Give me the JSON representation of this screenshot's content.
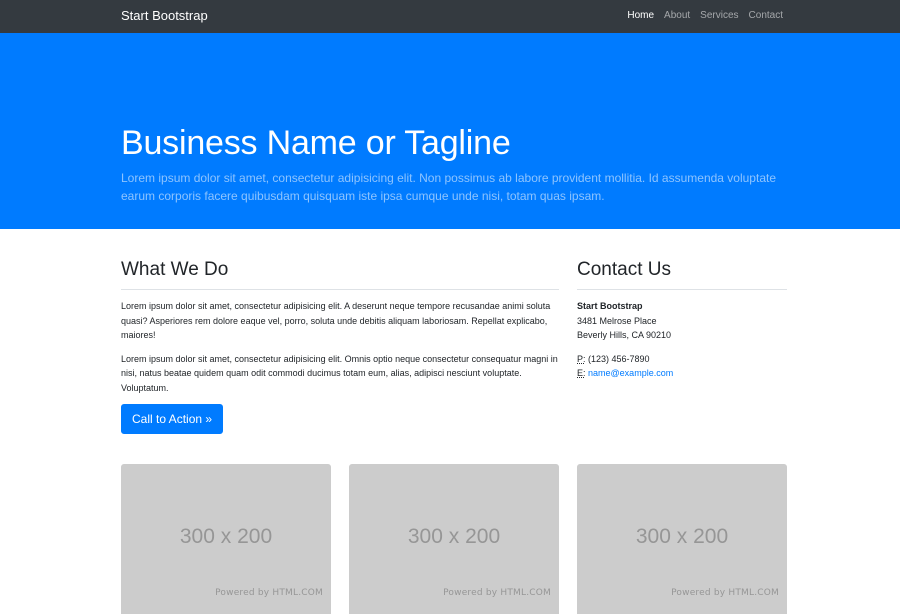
{
  "navbar": {
    "brand": "Start Bootstrap",
    "links": [
      "Home",
      "About",
      "Services",
      "Contact"
    ]
  },
  "hero": {
    "title": "Business Name or Tagline",
    "lead": "Lorem ipsum dolor sit amet, consectetur adipisicing elit. Non possimus ab labore provident mollitia. Id assumenda voluptate earum corporis facere quibusdam quisquam iste ipsa cumque unde nisi, totam quas ipsam."
  },
  "what_we_do": {
    "heading": "What We Do",
    "p1": "Lorem ipsum dolor sit amet, consectetur adipisicing elit. A deserunt neque tempore recusandae animi soluta quasi? Asperiores rem dolore eaque vel, porro, soluta unde debitis aliquam laboriosam. Repellat explicabo, maiores!",
    "p2": "Lorem ipsum dolor sit amet, consectetur adipisicing elit. Omnis optio neque consectetur consequatur magni in nisi, natus beatae quidem quam odit commodi ducimus totam eum, alias, adipisci nesciunt voluptate. Voluptatum.",
    "cta": "Call to Action »"
  },
  "contact": {
    "heading": "Contact Us",
    "name": "Start Bootstrap",
    "street": "3481 Melrose Place",
    "city": "Beverly Hills, CA 90210",
    "phone_abbr": "P:",
    "phone": " (123) 456-7890",
    "email_abbr": "E:",
    "email": "name@example.com"
  },
  "cards": [
    {
      "placeholder": "300 x 200",
      "credit": "Powered by HTML.COM"
    },
    {
      "placeholder": "300 x 200",
      "credit": "Powered by HTML.COM"
    },
    {
      "placeholder": "300 x 200",
      "credit": "Powered by HTML.COM"
    }
  ],
  "colors": {
    "navbar": "#343a40",
    "primary": "#007bff",
    "placeholder": "#cccccc"
  }
}
